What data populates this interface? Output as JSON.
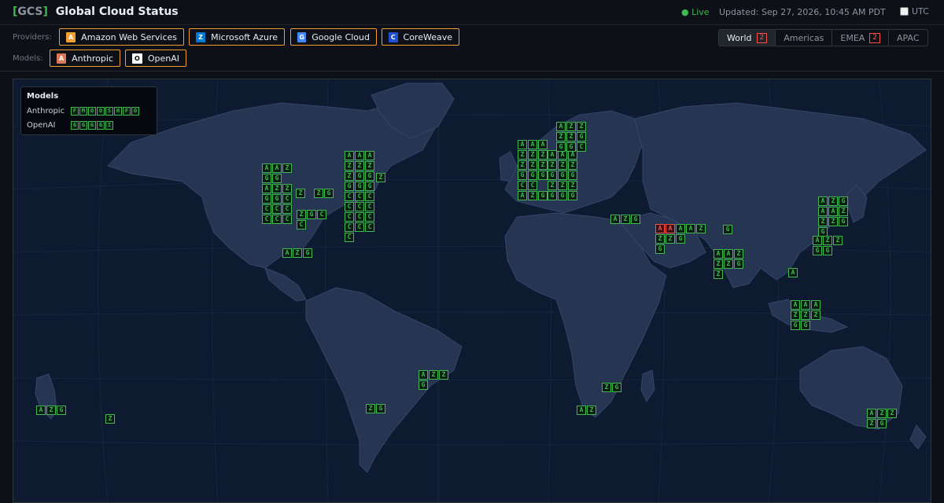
{
  "header": {
    "code": "GCS",
    "bracket_open": "[",
    "bracket_close": "]",
    "title": "Global Cloud Status",
    "live": "● Live",
    "updated": "Updated: Sep 27, 2026, 10:45 AM PDT",
    "utc_label": "UTC",
    "utc_checked": false
  },
  "filters": {
    "providers_label": "Providers:",
    "models_label": "Models:",
    "providers": [
      {
        "icon": "A",
        "label": "Amazon Web Services",
        "color": "#f0a030",
        "icon_name": "aws-icon"
      },
      {
        "icon": "Z",
        "label": "Microsoft Azure",
        "color": "#0078d4",
        "icon_name": "azure-icon"
      },
      {
        "icon": "G",
        "label": "Google Cloud",
        "color": "#4285f4",
        "icon_name": "gcp-icon"
      },
      {
        "icon": "C",
        "label": "CoreWeave",
        "color": "#2050d0",
        "icon_name": "coreweave-icon"
      }
    ],
    "models": [
      {
        "icon": "A",
        "label": "Anthropic",
        "color": "#d97757",
        "icon_name": "anthropic-icon"
      },
      {
        "icon": "O",
        "label": "OpenAI",
        "color": "#ffffff",
        "icon_name": "openai-icon"
      }
    ]
  },
  "regions": [
    {
      "label": "World",
      "badge": "2",
      "active": true
    },
    {
      "label": "Americas",
      "badge": "",
      "active": false
    },
    {
      "label": "EMEA",
      "badge": "2",
      "active": false
    },
    {
      "label": "APAC",
      "badge": "",
      "active": false
    }
  ],
  "legend": {
    "title": "Models",
    "rows": [
      {
        "name": "Anthropic",
        "tiles": [
          "F",
          "M",
          "O",
          "O",
          "S",
          "H",
          "F",
          "O"
        ]
      },
      {
        "name": "OpenAI",
        "tiles": [
          "G",
          "G",
          "G",
          "G",
          "I"
        ]
      }
    ]
  },
  "colors": {
    "ok": "#3fb950",
    "incident": "#f85149",
    "accent": "#f0a030",
    "ocean": "#0e1a30",
    "land": "#263552"
  },
  "clusters": [
    {
      "name": "us-west-north",
      "rows": [
        "AAZ",
        "GG",
        "AZZ",
        "GGC",
        "CCC",
        "CCC"
      ]
    },
    {
      "name": "us-central-1",
      "rows": [
        "Z"
      ]
    },
    {
      "name": "us-central-2",
      "rows": [
        "ZG"
      ]
    },
    {
      "name": "us-south-central",
      "rows": [
        "ZGC",
        "C"
      ]
    },
    {
      "name": "us-east",
      "rows": [
        "AAA",
        "ZZZ",
        "ZGG",
        "GGG",
        "CCC",
        "CCC",
        "CCC",
        "CCC",
        "C"
      ]
    },
    {
      "name": "us-east-extra",
      "rows": [
        "Z"
      ]
    },
    {
      "name": "mexico",
      "rows": [
        "AZG"
      ]
    },
    {
      "name": "eu-west",
      "rows": [
        "AAA",
        "ZZZ",
        "ZZZ",
        "GGG",
        "CC",
        "AZG"
      ]
    },
    {
      "name": "eu-central",
      "rows": [
        "AAA",
        "ZZZ",
        "GGG",
        "ZZZ",
        "GGG"
      ]
    },
    {
      "name": "eu-central-dup",
      "rows": [
        "AAA",
        "ZZZ",
        "ZZZ",
        "GGG",
        "GGG",
        "GGG"
      ]
    },
    {
      "name": "eu-north",
      "rows": [
        "AZZ",
        "ZZG",
        "GGC"
      ]
    },
    {
      "name": "middle-east-west",
      "rows": [
        "AZG"
      ]
    },
    {
      "name": "middle-east-gulf",
      "rows": [
        "AAZ",
        "ZZG",
        "G"
      ],
      "incidents": [
        "A",
        "A"
      ]
    },
    {
      "name": "central-asia",
      "rows": [
        "G"
      ]
    },
    {
      "name": "india",
      "rows": [
        "AAZ",
        "ZZG",
        "Z"
      ]
    },
    {
      "name": "se-asia-north",
      "rows": [
        "A"
      ]
    },
    {
      "name": "east-asia",
      "rows": [
        "AZZ",
        "GG"
      ]
    },
    {
      "name": "japan-korea",
      "rows": [
        "AZG",
        "AAZ",
        "ZZG",
        "G"
      ]
    },
    {
      "name": "se-asia-islands",
      "rows": [
        "AAA",
        "ZZZ",
        "GG"
      ]
    },
    {
      "name": "brazil",
      "rows": [
        "AZZ",
        "G"
      ]
    },
    {
      "name": "chile",
      "rows": [
        "ZG"
      ]
    },
    {
      "name": "south-africa-east",
      "rows": [
        "ZG"
      ]
    },
    {
      "name": "south-africa-west",
      "rows": [
        "AZ"
      ]
    },
    {
      "name": "pacific-west",
      "rows": [
        "AZG"
      ]
    },
    {
      "name": "pacific-mid",
      "rows": [
        "Z"
      ]
    },
    {
      "name": "australia",
      "rows": [
        "AZZ",
        "ZG"
      ]
    }
  ]
}
